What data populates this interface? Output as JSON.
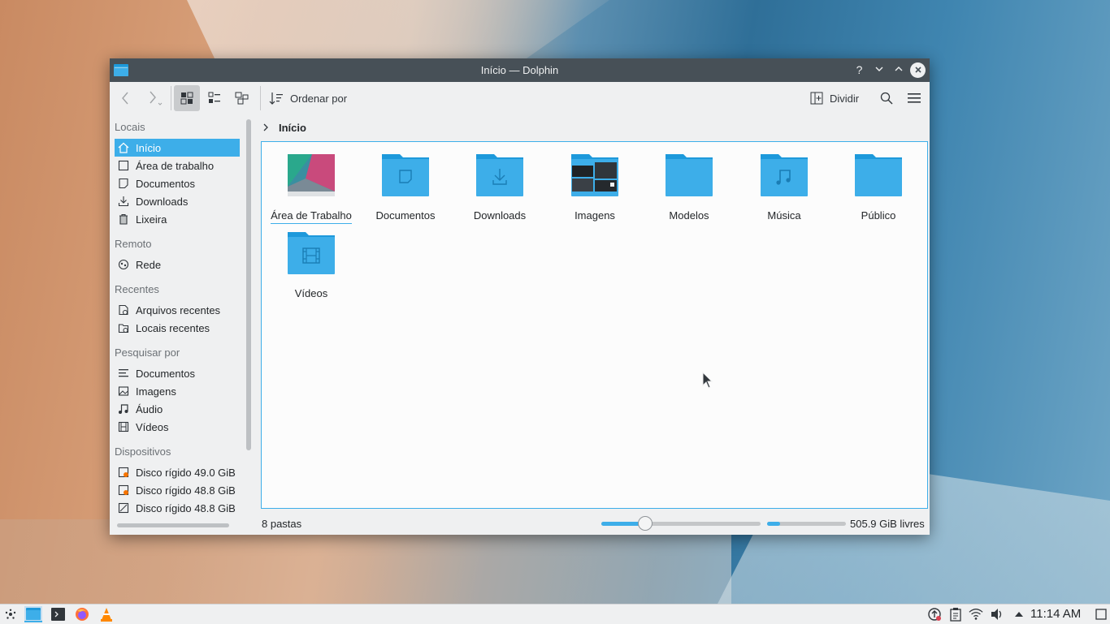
{
  "window": {
    "title": "Início — Dolphin"
  },
  "titlebar": {
    "help": "?",
    "minimize": "⌄",
    "maximize": "⌃",
    "close": "✕"
  },
  "toolbar": {
    "sort_label": "Ordenar por",
    "split_label": "Dividir"
  },
  "sidebar": {
    "sections": [
      {
        "title": "Locais",
        "items": [
          {
            "label": "Início",
            "icon": "home-icon",
            "selected": true
          },
          {
            "label": "Área de trabalho",
            "icon": "desktop-icon"
          },
          {
            "label": "Documentos",
            "icon": "document-icon"
          },
          {
            "label": "Downloads",
            "icon": "download-icon"
          },
          {
            "label": "Lixeira",
            "icon": "trash-icon"
          }
        ]
      },
      {
        "title": "Remoto",
        "items": [
          {
            "label": "Rede",
            "icon": "network-icon"
          }
        ]
      },
      {
        "title": "Recentes",
        "items": [
          {
            "label": "Arquivos recentes",
            "icon": "recent-files-icon"
          },
          {
            "label": "Locais recentes",
            "icon": "recent-places-icon"
          }
        ]
      },
      {
        "title": "Pesquisar por",
        "items": [
          {
            "label": "Documentos",
            "icon": "text-document-icon"
          },
          {
            "label": "Imagens",
            "icon": "image-icon"
          },
          {
            "label": "Áudio",
            "icon": "audio-icon"
          },
          {
            "label": "Vídeos",
            "icon": "video-icon"
          }
        ]
      },
      {
        "title": "Dispositivos",
        "items": [
          {
            "label": "Disco rígido 49.0 GiB",
            "icon": "hard-disk-warning-icon"
          },
          {
            "label": "Disco rígido 48.8 GiB",
            "icon": "hard-disk-warning-icon"
          },
          {
            "label": "Disco rígido 48.8 GiB",
            "icon": "hard-disk-icon"
          }
        ]
      }
    ]
  },
  "breadcrumb": {
    "current": "Início"
  },
  "folders": [
    {
      "label": "Área de Trabalho",
      "kind": "desktop-thumbnail"
    },
    {
      "label": "Documentos",
      "kind": "documents"
    },
    {
      "label": "Downloads",
      "kind": "downloads"
    },
    {
      "label": "Imagens",
      "kind": "images-thumbnail"
    },
    {
      "label": "Modelos",
      "kind": "plain"
    },
    {
      "label": "Música",
      "kind": "music"
    },
    {
      "label": "Público",
      "kind": "plain"
    },
    {
      "label": "Vídeos",
      "kind": "videos"
    }
  ],
  "status": {
    "count": "8 pastas",
    "free_space": "505.9 GiB livres",
    "zoom_level": 0.27,
    "disk_used_fraction": 0.17
  },
  "taskbar": {
    "clock": "11:14 AM"
  },
  "colors": {
    "accent": "#3daee9",
    "titlebar": "#475057",
    "folder": "#3daee9",
    "folder_tab": "#1d99db"
  }
}
